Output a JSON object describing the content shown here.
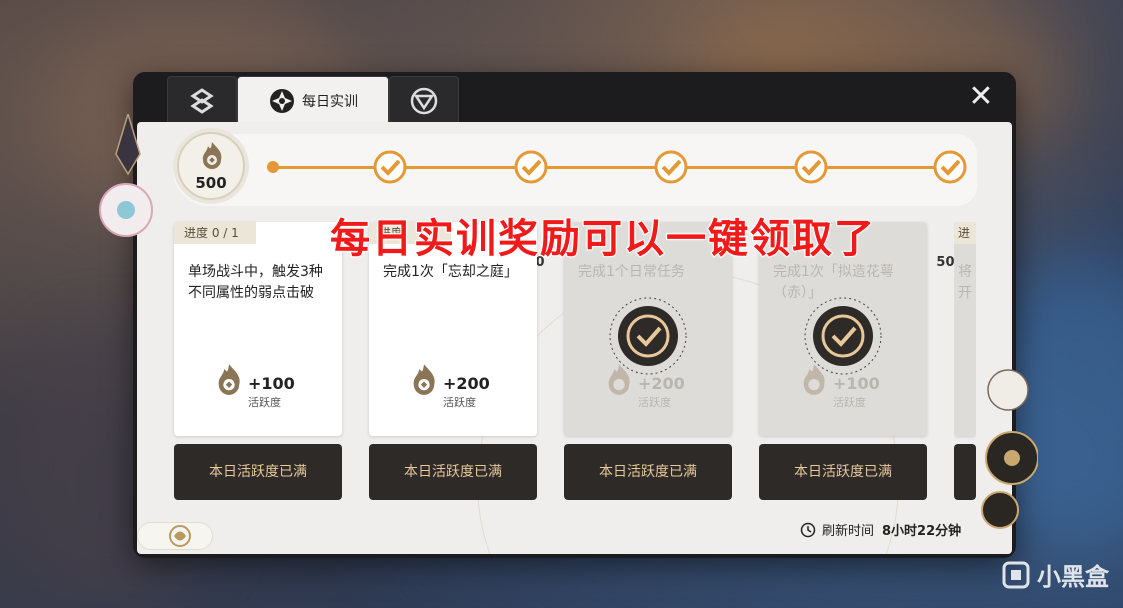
{
  "tabs": [
    {
      "label": "",
      "icon": "swirl-icon"
    },
    {
      "label": "每日实训",
      "icon": "daily-training-icon"
    },
    {
      "label": "",
      "icon": "shield-icon"
    }
  ],
  "activity": {
    "total": "500",
    "milestones": [
      "0",
      "100",
      "200",
      "300",
      "400",
      "500"
    ]
  },
  "cards": [
    {
      "progress": "进度 0 / 1",
      "desc": "单场战斗中，触发3种不同属性的弱点击破",
      "reward": "+100",
      "reward_label": "活跃度",
      "button": "本日活跃度已满",
      "done": false
    },
    {
      "progress": "进度",
      "desc": "完成1次「忘却之庭」",
      "reward": "+200",
      "reward_label": "活跃度",
      "button": "本日活跃度已满",
      "done": false
    },
    {
      "progress": "",
      "desc": "完成1个日常任务",
      "reward": "+200",
      "reward_label": "活跃度",
      "button": "本日活跃度已满",
      "done": true
    },
    {
      "progress": "",
      "desc": "完成1次「拟造花萼（赤）」",
      "reward": "+100",
      "reward_label": "活跃度",
      "button": "本日活跃度已满",
      "done": true
    },
    {
      "progress": "进",
      "desc": "将 开",
      "reward": "",
      "reward_label": "",
      "button": "",
      "done": true
    }
  ],
  "refresh": {
    "label": "刷新时间",
    "value": "8小时22分钟"
  },
  "annotation": "每日实训奖励可以一键领取了",
  "watermark": "小黑盒",
  "colors": {
    "accent": "#e39a36",
    "button_text": "#e8c89a",
    "annotation": "#f01a1a"
  }
}
